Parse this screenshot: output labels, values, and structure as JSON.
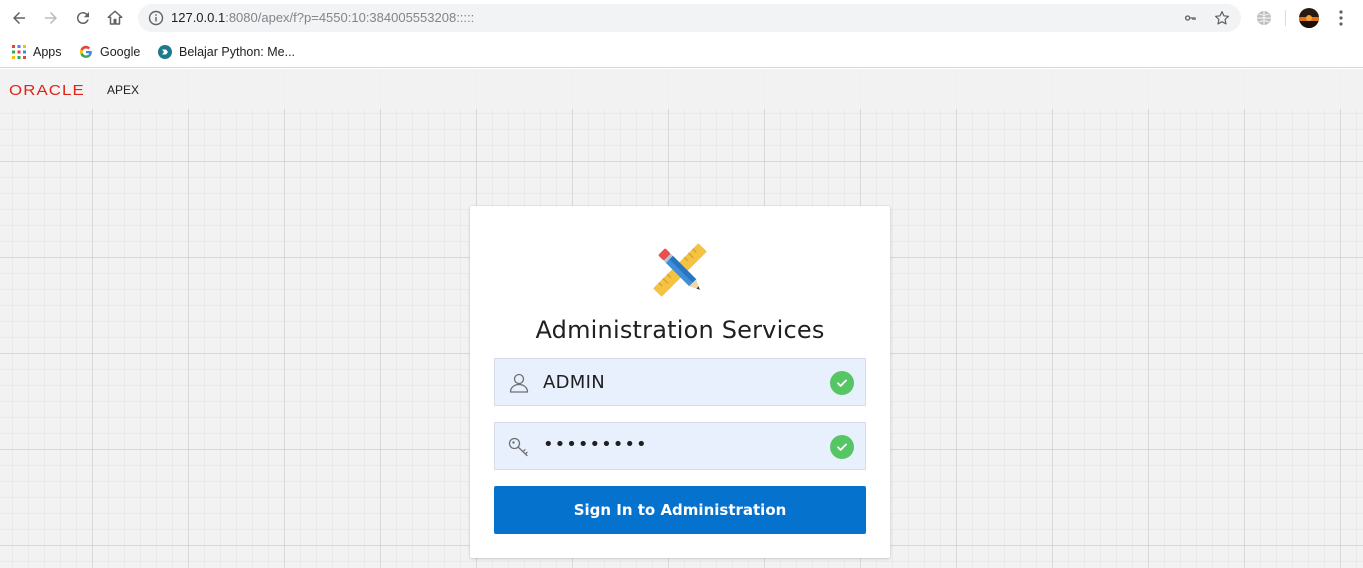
{
  "browser": {
    "url_host": "127.0.0.1",
    "url_rest": ":8080/apex/f?p=4550:10:384005553208:::::",
    "bookmarks": [
      {
        "label": "Apps",
        "icon": "apps-grid-icon"
      },
      {
        "label": "Google",
        "icon": "google-g-icon"
      },
      {
        "label": "Belajar Python: Me...",
        "icon": "python-site-icon"
      }
    ]
  },
  "header": {
    "oracle_logo": "ORACLE",
    "product": "APEX"
  },
  "login": {
    "title": "Administration Services",
    "username_value": "ADMIN",
    "password_value": "•••••••••",
    "signin_label": "Sign In to Administration"
  },
  "colors": {
    "accent": "#0572ce",
    "oracle_red": "#e2231a",
    "valid_green": "#56c664",
    "field_bg": "#e8f0fe"
  }
}
